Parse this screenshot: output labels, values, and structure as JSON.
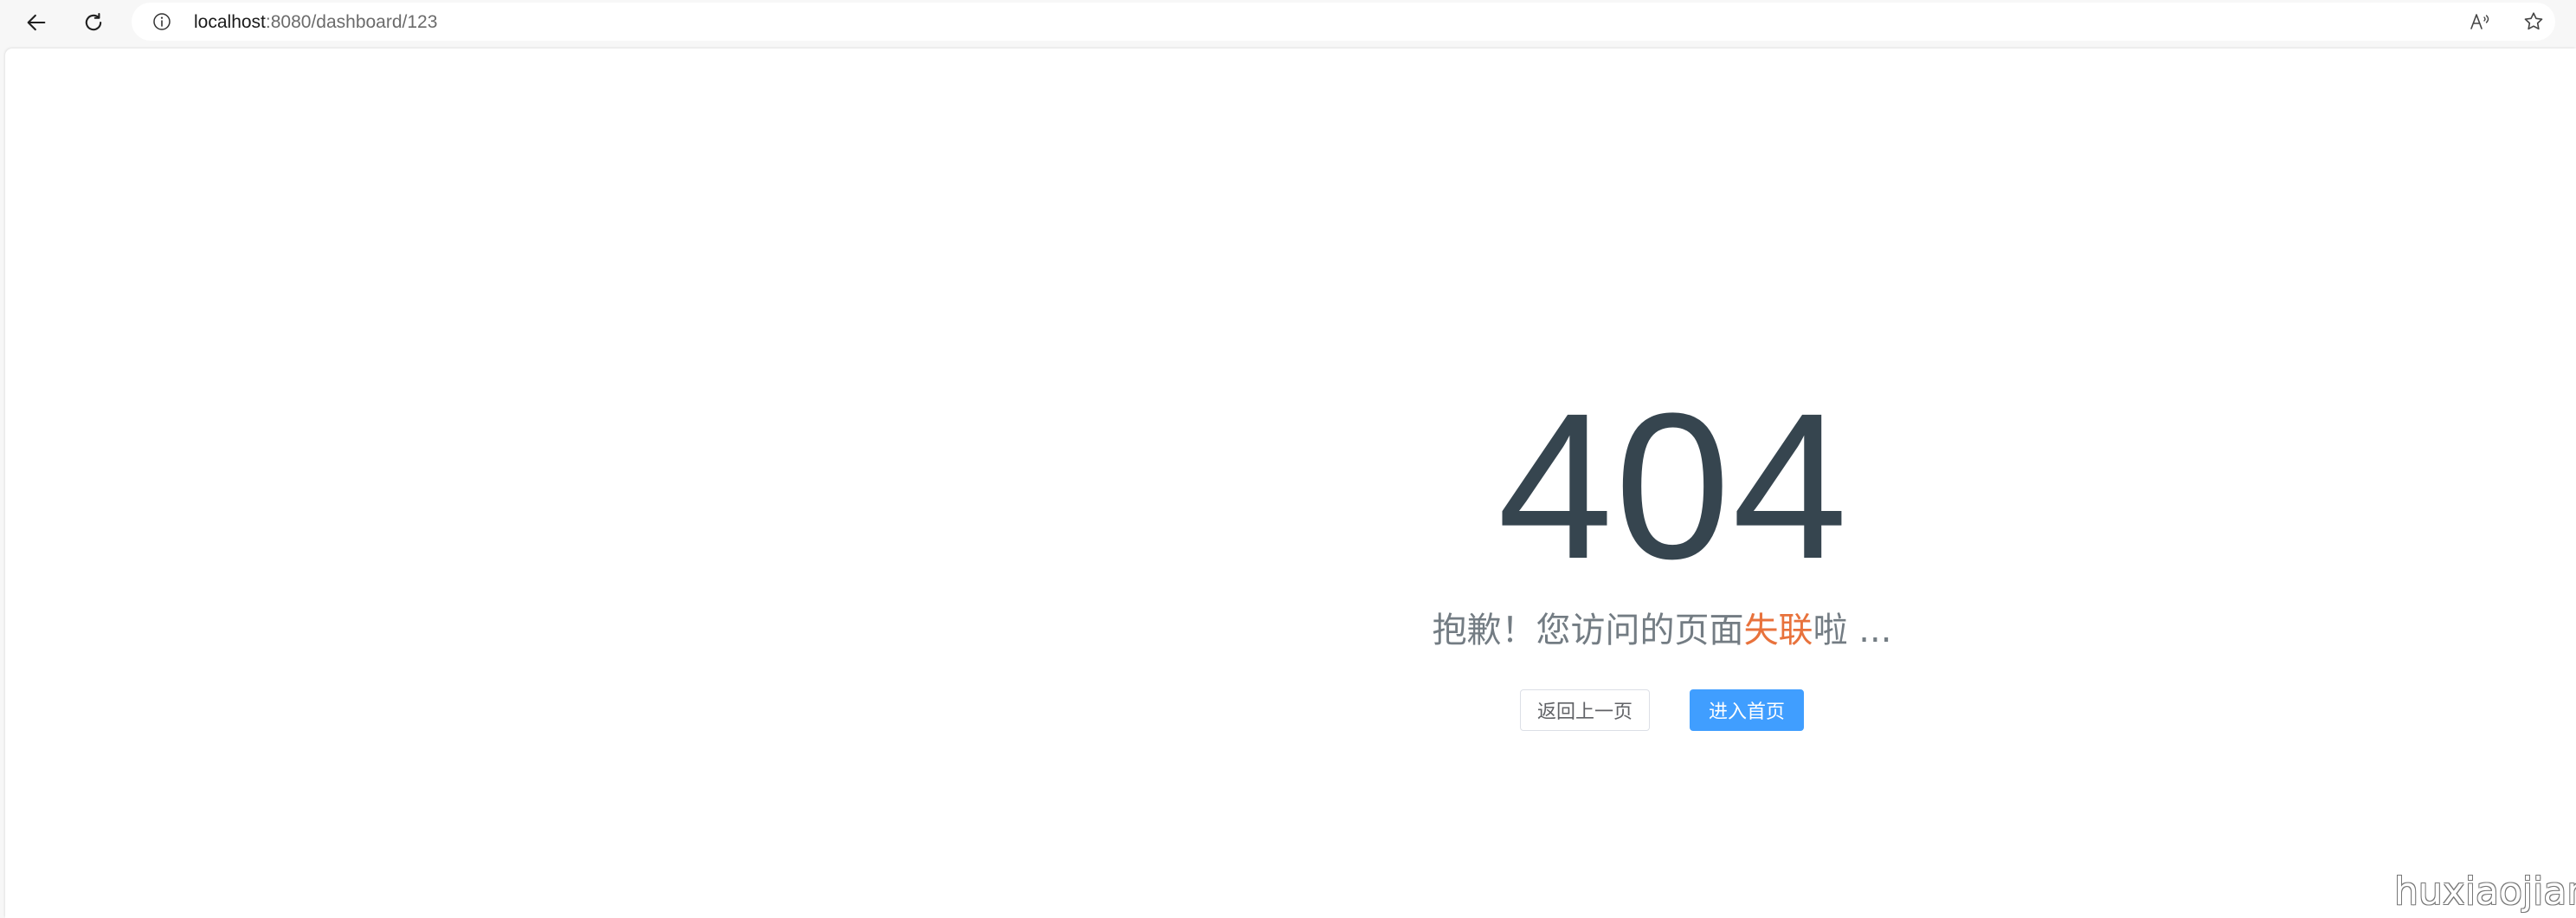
{
  "browser": {
    "url_host": "localhost",
    "url_rest": ":8080/dashboard/123",
    "icons": {
      "back": "arrow-left-icon",
      "reload": "reload-icon",
      "site_info": "info-icon",
      "read_aloud": "read-aloud-icon",
      "favorite": "star-icon"
    }
  },
  "page": {
    "error_code": "404",
    "message_prefix": "抱歉！您访问的页面",
    "message_highlight": "失联",
    "message_suffix": "啦 ...",
    "back_button_label": "返回上一页",
    "home_button_label": "进入首页"
  },
  "watermark": "huxiaojian",
  "colors": {
    "error_code": "#36454f",
    "message": "#737c83",
    "highlight": "#e8723c",
    "primary_button": "#409eff"
  }
}
